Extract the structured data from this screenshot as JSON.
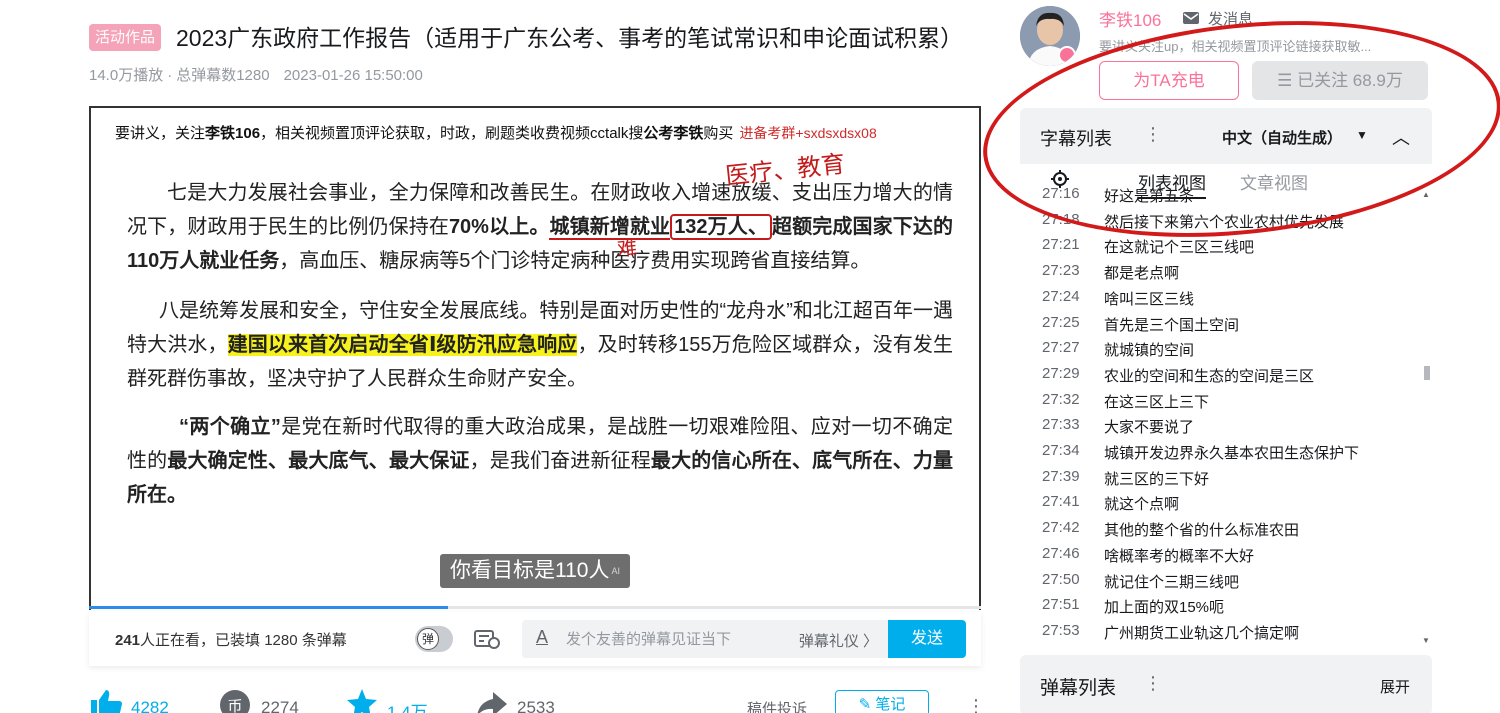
{
  "video": {
    "tag": "活动作品",
    "title": "2023广东政府工作报告（适用于广东公考、事考的笔试常识和申论面试积累）",
    "plays": "14.0万播放",
    "danmaku_count": "总弹幕数1280",
    "date": "2023-01-26 15:50:00"
  },
  "player": {
    "header_prefix": "要讲义，关注",
    "header_name": "李铁106",
    "header_mid": "，相关视频置顶评论获取，时政，刷题类收费视频cctalk搜",
    "header_name2": "公考李铁",
    "header_suffix": "购买",
    "header_red": "进备考群+sxdsxdsx08",
    "p1_a": "七是大力发展社会事业，全力保障和改善民生。在财政收入增速放缓、支出压力增大的情况下，财政用于民生的比例仍保持在",
    "p1_b": "70%以上。",
    "p1_c": "城镇新增就业",
    "p1_d": "132万人、",
    "p1_e": "超额完成国家下达的110万人就业任务",
    "p1_f": "，高血压、糖尿病等5个门诊特定病种医疗费用实现跨省直接结算。",
    "p2_a": "八是统筹发展和安全，守住安全发展底线。特别是面对历史性的“龙舟水”和北江超百年一遇特大洪水，",
    "p2_b": "建国以来首次启动全省Ⅰ级防汛应急响应",
    "p2_c": "，及时转移155万危险区域群众，没有发生群死群伤事故，坚决守护了人民群众生命财产安全。",
    "p3_a": "“两个确立”",
    "p3_b": "是党在新时代取得的重大政治成果，是战胜一切艰难险阻、应对一切不确定性的",
    "p3_c": "最大确定性、最大底气、最大保证",
    "p3_d": "，是我们奋进新征程",
    "p3_e": "最大的信心所在、底气所在、力量所在。",
    "handwriting_1": "医疗、教育",
    "handwriting_2": "难",
    "subtitle": "你看目标是110人",
    "subtitle_ai": "AI",
    "progress": 0.402
  },
  "danmaku_bar": {
    "viewers_count": "241",
    "viewers_text": "人正在看，已装填 1280 条弹幕",
    "toggle_label": "弹",
    "a_icon": "A",
    "placeholder": "发个友善的弹幕见证当下",
    "etiquette": "弹幕礼仪 〉",
    "send": "发送"
  },
  "actions": {
    "likes": "4282",
    "coins": "2274",
    "favorites": "1.4万",
    "shares": "2533",
    "report": "稿件投诉",
    "note": "笔记"
  },
  "uploader": {
    "name": "李铁106",
    "message": "发消息",
    "description": "要讲义关注up，相关视频置顶评论链接获取敏...",
    "charge": "为TA充电",
    "follow": "☰ 已关注 68.9万"
  },
  "subtitles_panel": {
    "title": "字幕列表",
    "language": "中文（自动生成）",
    "tab_list": "列表视图",
    "tab_article": "文章视图",
    "rows": [
      {
        "time": "27:16",
        "text": "好这是第五条"
      },
      {
        "time": "27:18",
        "text": "然后接下来第六个农业农村优先发展"
      },
      {
        "time": "27:21",
        "text": "在这就记个三区三线吧"
      },
      {
        "time": "27:23",
        "text": "都是老点啊"
      },
      {
        "time": "27:24",
        "text": "啥叫三区三线"
      },
      {
        "time": "27:25",
        "text": "首先是三个国土空间"
      },
      {
        "time": "27:27",
        "text": "就城镇的空间"
      },
      {
        "time": "27:29",
        "text": "农业的空间和生态的空间是三区"
      },
      {
        "time": "27:32",
        "text": "在这三区上三下"
      },
      {
        "time": "27:33",
        "text": "大家不要说了"
      },
      {
        "time": "27:34",
        "text": "城镇开发边界永久基本农田生态保护下"
      },
      {
        "time": "27:39",
        "text": "就三区的三下好"
      },
      {
        "time": "27:41",
        "text": "就这个点啊"
      },
      {
        "time": "27:42",
        "text": "其他的整个省的什么标准农田"
      },
      {
        "time": "27:46",
        "text": "啥概率考的概率不大好"
      },
      {
        "time": "27:50",
        "text": "就记住个三期三线吧"
      },
      {
        "time": "27:51",
        "text": "加上面的双15%呃"
      },
      {
        "time": "27:53",
        "text": "广州期货工业轨这几个搞定啊"
      }
    ]
  },
  "danmaku_panel": {
    "title": "弹幕列表",
    "expand": "展开"
  },
  "colors": {
    "accent_blue": "#00aeec",
    "pink": "#fb7299",
    "annotation_red": "#d21a1a",
    "highlight_yellow": "#f7f21d"
  }
}
